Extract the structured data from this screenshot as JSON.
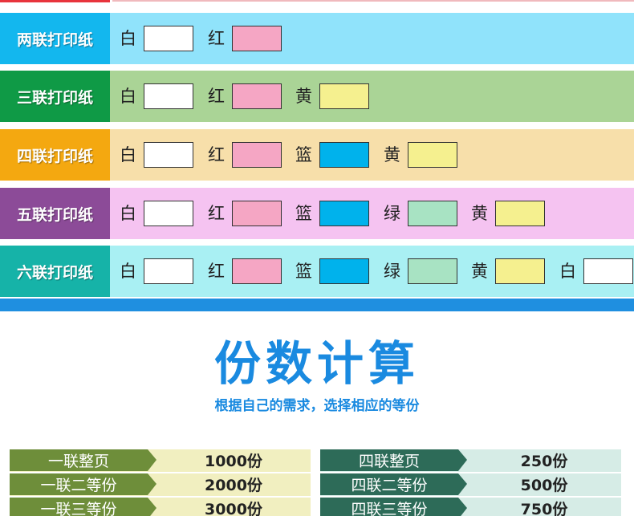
{
  "rows": [
    {
      "label": "两联打印纸",
      "label_color": "#13b7ee",
      "bg": "#90e3fb",
      "items": [
        {
          "c": "白",
          "sw": "#ffffff"
        },
        {
          "c": "红",
          "sw": "#f5a6c4"
        }
      ]
    },
    {
      "label": "三联打印纸",
      "label_color": "#0f9a46",
      "bg": "#aad496",
      "items": [
        {
          "c": "白",
          "sw": "#ffffff"
        },
        {
          "c": "红",
          "sw": "#f5a6c4"
        },
        {
          "c": "黄",
          "sw": "#f5f08f"
        }
      ]
    },
    {
      "label": "四联打印纸",
      "label_color": "#f4a810",
      "bg": "#f7dfaa",
      "items": [
        {
          "c": "白",
          "sw": "#ffffff"
        },
        {
          "c": "红",
          "sw": "#f5a6c4"
        },
        {
          "c": "篮",
          "sw": "#00b2ec"
        },
        {
          "c": "黄",
          "sw": "#f5f08f"
        }
      ]
    },
    {
      "label": "五联打印纸",
      "label_color": "#8c4b98",
      "bg": "#f5c3f1",
      "items": [
        {
          "c": "白",
          "sw": "#ffffff"
        },
        {
          "c": "红",
          "sw": "#f5a6c4"
        },
        {
          "c": "篮",
          "sw": "#00b2ec"
        },
        {
          "c": "绿",
          "sw": "#a8e3c3"
        },
        {
          "c": "黄",
          "sw": "#f5f08f"
        }
      ]
    },
    {
      "label": "六联打印纸",
      "label_color": "#16b3a8",
      "bg": "#a9f0f3",
      "items": [
        {
          "c": "白",
          "sw": "#ffffff"
        },
        {
          "c": "红",
          "sw": "#f5a6c4"
        },
        {
          "c": "篮",
          "sw": "#00b2ec"
        },
        {
          "c": "绿",
          "sw": "#a8e3c3"
        },
        {
          "c": "黄",
          "sw": "#f5f08f"
        },
        {
          "c": "白",
          "sw": "#ffffff"
        }
      ]
    }
  ],
  "title": "份数计算",
  "subtitle": "根据自己的需求，选择相应的等份",
  "tables": [
    {
      "label_bg": "#6e8e3a",
      "value_bg": "#f1efc0",
      "rows": [
        {
          "label": "一联整页",
          "value": "1000份"
        },
        {
          "label": "一联二等份",
          "value": "2000份"
        },
        {
          "label": "一联三等份",
          "value": "3000份"
        }
      ]
    },
    {
      "label_bg": "#2d6b58",
      "value_bg": "#d6ece6",
      "rows": [
        {
          "label": "四联整页",
          "value": "250份"
        },
        {
          "label": "四联二等份",
          "value": "500份"
        },
        {
          "label": "四联三等份",
          "value": "750份"
        }
      ]
    }
  ]
}
